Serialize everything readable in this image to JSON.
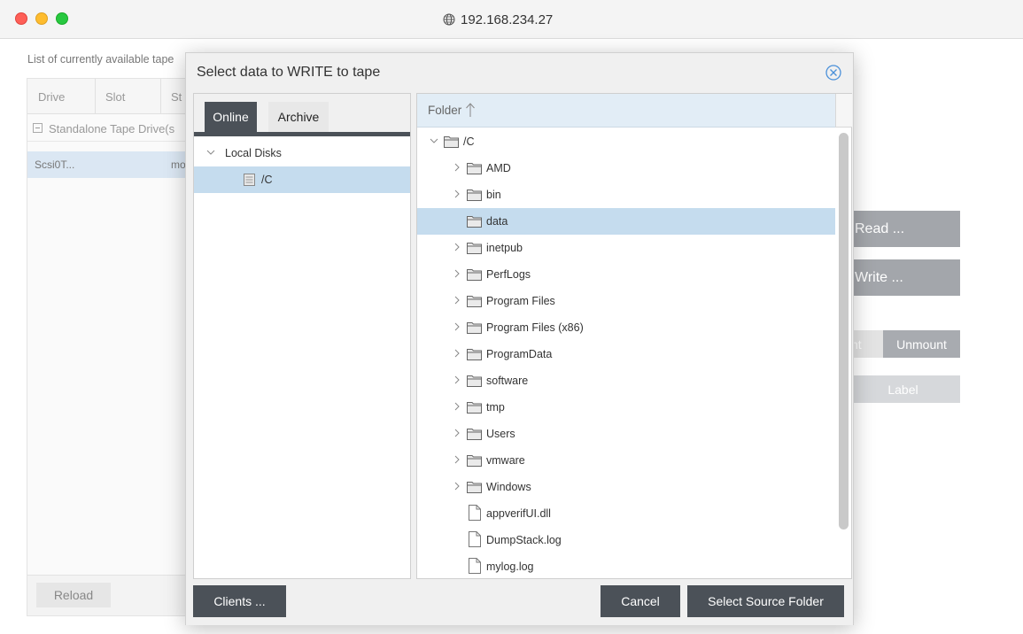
{
  "window": {
    "url": "192.168.234.27"
  },
  "background": {
    "caption": "List of currently available tape",
    "columns": [
      "Drive",
      "Slot",
      "St"
    ],
    "group_label": "Standalone Tape Drive(s",
    "row": {
      "drive": "Scsi0T...",
      "status": "mo"
    },
    "reload_label": "Reload",
    "read_label": "Read ...",
    "write_label": "Write ...",
    "mount_label": "nt",
    "unmount_label": "Unmount",
    "label_label": "Label"
  },
  "dialog": {
    "title": "Select data to WRITE to tape",
    "tabs": [
      {
        "label": "Online",
        "active": true
      },
      {
        "label": "Archive",
        "active": false
      }
    ],
    "left_tree": {
      "root_label": "Local Disks",
      "drive_label": "/C"
    },
    "column_header": "Folder",
    "items": [
      {
        "label": "/C",
        "kind": "folder",
        "expanded": true,
        "depth": 0
      },
      {
        "label": "AMD",
        "kind": "folder",
        "depth": 1
      },
      {
        "label": "bin",
        "kind": "folder",
        "depth": 1
      },
      {
        "label": "data",
        "kind": "folder",
        "depth": 1,
        "selected": true,
        "no_chevron": true
      },
      {
        "label": "inetpub",
        "kind": "folder",
        "depth": 1
      },
      {
        "label": "PerfLogs",
        "kind": "folder",
        "depth": 1
      },
      {
        "label": "Program Files",
        "kind": "folder",
        "depth": 1
      },
      {
        "label": "Program Files (x86)",
        "kind": "folder",
        "depth": 1
      },
      {
        "label": "ProgramData",
        "kind": "folder",
        "depth": 1
      },
      {
        "label": "software",
        "kind": "folder",
        "depth": 1
      },
      {
        "label": "tmp",
        "kind": "folder",
        "depth": 1
      },
      {
        "label": "Users",
        "kind": "folder",
        "depth": 1
      },
      {
        "label": "vmware",
        "kind": "folder",
        "depth": 1
      },
      {
        "label": "Windows",
        "kind": "folder",
        "depth": 1
      },
      {
        "label": "appverifUI.dll",
        "kind": "file",
        "depth": 1
      },
      {
        "label": "DumpStack.log",
        "kind": "file",
        "depth": 1
      },
      {
        "label": "mylog.log",
        "kind": "file",
        "depth": 1
      }
    ],
    "buttons": {
      "clients": "Clients ...",
      "cancel": "Cancel",
      "select": "Select Source Folder"
    }
  },
  "colors": {
    "dark_button": "#4b5158",
    "selection": "#c5dcee",
    "header_blue": "#e2edf6",
    "close_icon": "#4a90d9"
  }
}
